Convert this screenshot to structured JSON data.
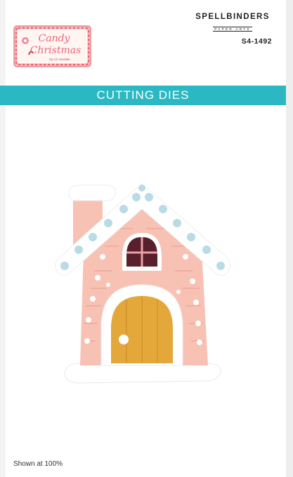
{
  "logo": {
    "line1": "Candy",
    "line2": "Christmas",
    "byline": "by Liz Jourdan"
  },
  "brand": {
    "name": "SPELLBINDERS",
    "sub": "PAPER ARTS"
  },
  "sku": "S4-1492",
  "banner": {
    "title": "CUTTING DIES"
  },
  "footer": {
    "scale_note": "Shown at 100%"
  },
  "colors": {
    "banner": "#2bb8c3",
    "house": "#f7c2b3",
    "frosting": "#ffffff",
    "candy": "#b9dbe5",
    "door": "#e4a739",
    "window": "#5a1f2d"
  }
}
